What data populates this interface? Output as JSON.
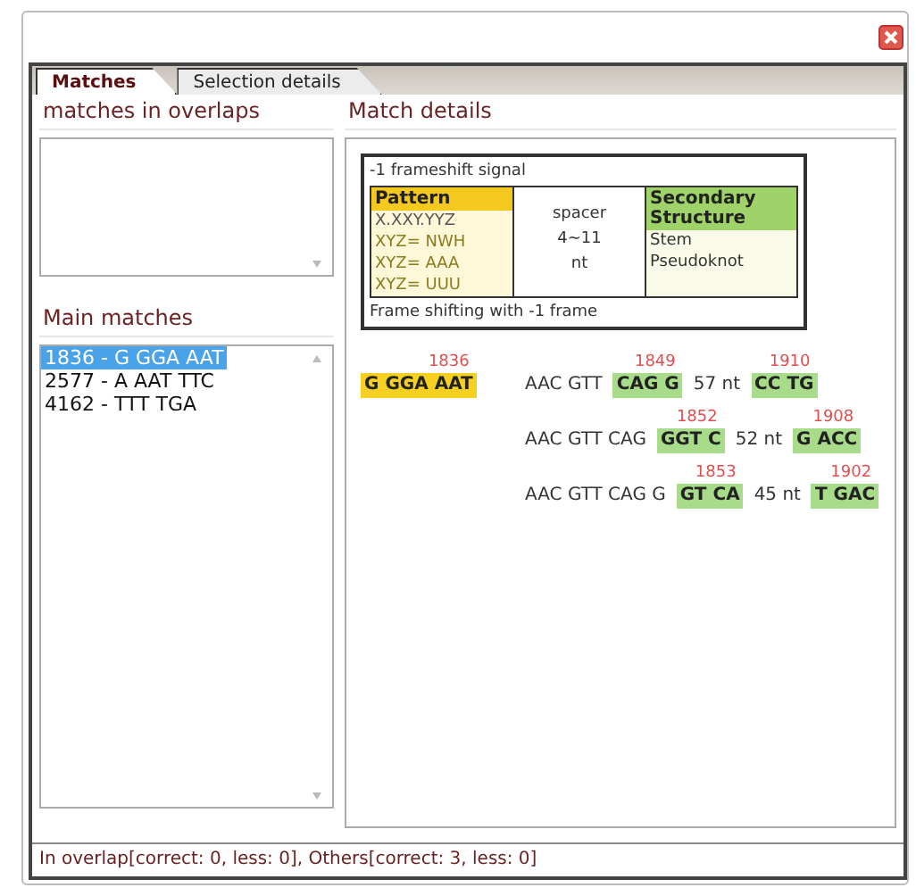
{
  "tabs": [
    {
      "label": "Matches",
      "selected": true
    },
    {
      "label": "Selection details",
      "selected": false
    }
  ],
  "overlaps": {
    "title": "matches in overlaps"
  },
  "main_matches": {
    "title": "Main matches",
    "items": [
      {
        "label": "1836 - G GGA AAT",
        "selected": true
      },
      {
        "label": "2577 - A AAT TTC",
        "selected": false
      },
      {
        "label": "4162 - TTT TGA",
        "selected": false
      }
    ]
  },
  "match_details": {
    "title": "Match details",
    "signal": {
      "title": "-1 frameshift signal",
      "pattern": {
        "header": "Pattern",
        "lines": [
          "X.XXY.YYZ",
          "XYZ= NWH",
          "XYZ= AAA",
          "XYZ= UUU"
        ]
      },
      "spacer": {
        "lines": [
          "spacer",
          "4~11",
          "nt"
        ]
      },
      "structure": {
        "header": "Secondary Structure",
        "lines": [
          "Stem",
          "Pseudoknot"
        ]
      },
      "footer": "Frame shifting with -1 frame"
    },
    "rows": [
      {
        "segments": [
          {
            "text": "G GGA AAT",
            "kind": "slippery",
            "label": "1836"
          },
          {
            "text": "AAC GTT",
            "kind": "plain"
          },
          {
            "text": "CAG G",
            "kind": "stem",
            "label": "1849"
          },
          {
            "text": "57 nt",
            "kind": "plain"
          },
          {
            "text": "CC TG",
            "kind": "stem",
            "label": "1910"
          }
        ]
      },
      {
        "segments": [
          {
            "text": "AAC GTT CAG",
            "kind": "plain"
          },
          {
            "text": "GGT C",
            "kind": "stem",
            "label": "1852"
          },
          {
            "text": "52 nt",
            "kind": "plain"
          },
          {
            "text": "G ACC",
            "kind": "stem",
            "label": "1908"
          }
        ]
      },
      {
        "segments": [
          {
            "text": "AAC GTT CAG G",
            "kind": "plain"
          },
          {
            "text": "GT CA",
            "kind": "stem",
            "label": "1853"
          },
          {
            "text": "45 nt",
            "kind": "plain"
          },
          {
            "text": "T GAC",
            "kind": "stem",
            "label": "1902"
          }
        ]
      }
    ]
  },
  "status_bar": "In overlap[correct: 0, less: 0], Others[correct: 3, less: 0]"
}
